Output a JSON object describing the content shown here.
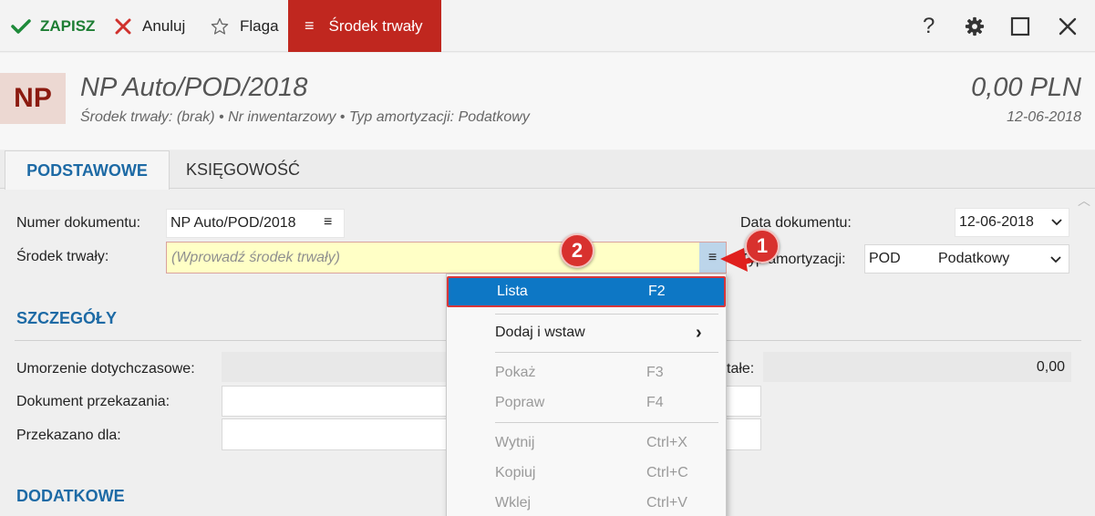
{
  "toolbar": {
    "save_label": "ZAPISZ",
    "cancel_label": "Anuluj",
    "flag_label": "Flaga",
    "asset_label": "Środek trwały",
    "help_label": "?"
  },
  "header": {
    "badge": "NP",
    "title": "NP Auto/POD/2018",
    "subtitle": "Środek trwały: (brak) • Nr inwentarzowy • Typ amortyzacji: Podatkowy",
    "amount": "0,00 PLN",
    "date": "12-06-2018"
  },
  "tabs": [
    {
      "label": "PODSTAWOWE",
      "active": true
    },
    {
      "label": "KSIĘGOWOŚĆ",
      "active": false
    }
  ],
  "form": {
    "doc_number_label": "Numer dokumentu:",
    "doc_number_value": "NP Auto/POD/2018",
    "asset_label": "Środek trwały:",
    "asset_placeholder": "(Wprowadź środek trwały)",
    "doc_date_label": "Data dokumentu:",
    "doc_date_value": "12-06-2018",
    "amort_type_label": "Typ amortyzacji:",
    "amort_type_code": "POD",
    "amort_type_name": "Podatkowy"
  },
  "details": {
    "section_title": "SZCZEGÓŁY",
    "depreciation_label": "Umorzenie dotychczasowe:",
    "transfer_doc_label": "Dokument przekazania:",
    "transferred_to_label": "Przekazano dla:",
    "right_label_fragment": "tałe:",
    "right_value": "0,00"
  },
  "additional": {
    "section_title": "DODATKOWE"
  },
  "menu": {
    "items": [
      {
        "label": "Lista",
        "shortcut": "F2",
        "state": "highlighted"
      },
      {
        "label": "Dodaj i wstaw",
        "shortcut": "",
        "state": "submenu"
      },
      {
        "label": "Pokaż",
        "shortcut": "F3",
        "state": "disabled"
      },
      {
        "label": "Popraw",
        "shortcut": "F4",
        "state": "disabled"
      },
      {
        "label": "Wytnij",
        "shortcut": "Ctrl+X",
        "state": "disabled"
      },
      {
        "label": "Kopiuj",
        "shortcut": "Ctrl+C",
        "state": "disabled"
      },
      {
        "label": "Wklej",
        "shortcut": "Ctrl+V",
        "state": "disabled"
      }
    ],
    "submenu_arrow": "›"
  },
  "callouts": [
    "1",
    "2"
  ],
  "colors": {
    "accent": "#c0271f",
    "link_blue": "#1d6aa5",
    "highlight_blue": "#0d77c5",
    "callout_red": "#d8312e",
    "asset_field_bg": "#ffffc6"
  },
  "icons": [
    "check-icon",
    "x-icon",
    "star-icon",
    "burger-icon",
    "help-icon",
    "gear-icon",
    "maximize-icon",
    "close-icon",
    "chevron-down-icon",
    "chevron-up-icon",
    "chevron-right-icon",
    "arrow-icon"
  ]
}
